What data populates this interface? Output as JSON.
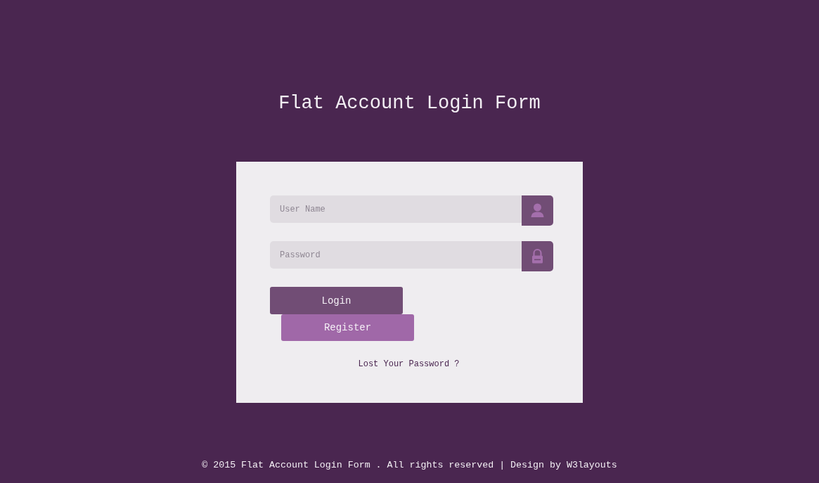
{
  "page": {
    "title": "Flat Account Login Form"
  },
  "form": {
    "fields": [
      {
        "kind": "text",
        "placeholder": "User Name"
      },
      {
        "kind": "password",
        "placeholder": "Password"
      }
    ],
    "buttons": [
      {
        "kind": "primary",
        "label": "Login"
      },
      {
        "kind": "secondary",
        "label": "Register"
      }
    ],
    "forgot_link": "Lost Your Password ?"
  },
  "footer": {
    "text": "© 2015 Flat Account Login Form . All rights reserved | Design by",
    "link": "W3layouts"
  }
}
